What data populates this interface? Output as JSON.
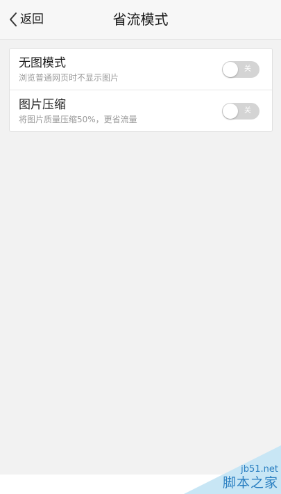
{
  "nav": {
    "back_label": "返回",
    "title": "省流模式"
  },
  "settings": [
    {
      "title": "无图模式",
      "description": "浏览普通网页时不显示图片",
      "toggle_text": "关",
      "enabled": false
    },
    {
      "title": "图片压缩",
      "description": "将图片质量压缩50%，更省流量",
      "toggle_text": "关",
      "enabled": false
    }
  ],
  "watermark": {
    "site": "jb51.net",
    "name": "脚本之家"
  },
  "colors": {
    "background": "#f2f2f2",
    "toggle_off": "#d4d4d4",
    "watermark": "#2a7fc1"
  }
}
